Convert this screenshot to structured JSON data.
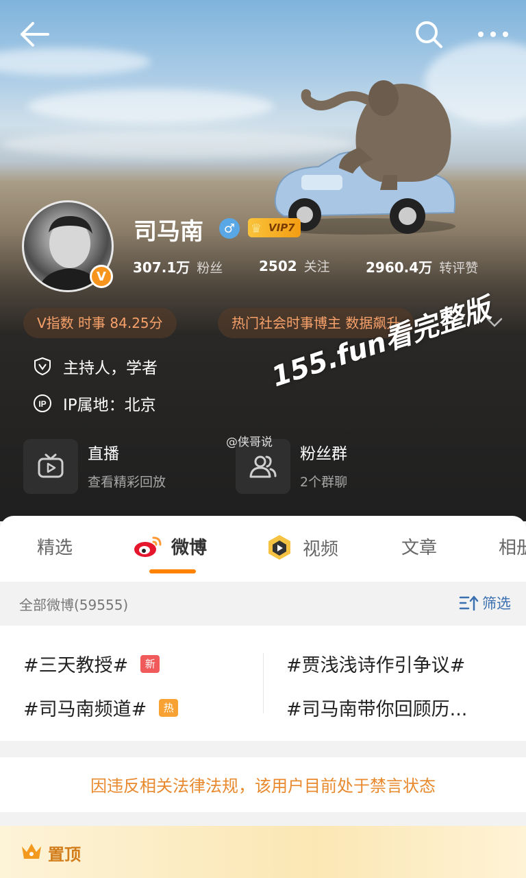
{
  "profile": {
    "name": "司马南",
    "vip_label": "VIP7",
    "verified_mark": "V",
    "stats": [
      {
        "value": "307.1万",
        "label": "粉丝"
      },
      {
        "value": "2502",
        "label": "关注"
      },
      {
        "value": "2960.4万",
        "label": "转评赞"
      }
    ],
    "chips": [
      "V指数 时事 84.25分",
      "热门社会时事博主 数据飙升"
    ],
    "occupation": "主持人，学者",
    "ip_location": "IP属地：北京"
  },
  "cards": [
    {
      "title": "直播",
      "subtitle": "查看精彩回放",
      "icon": "tv-icon"
    },
    {
      "title": "粉丝群",
      "subtitle": "2个群聊",
      "icon": "group-icon"
    }
  ],
  "overlay": {
    "watermark": "155.fun看完整版",
    "credit": "@侠哥说"
  },
  "tabs": [
    "精选",
    "微博",
    "视频",
    "文章",
    "相册"
  ],
  "active_tab": "微博",
  "feed": {
    "count_label": "全部微博(59555)",
    "filter_label": "筛选"
  },
  "topics": [
    {
      "text": "#三天教授#",
      "badge": "新",
      "badge_color": "#f05a5a"
    },
    {
      "text": "#贾浅浅诗作引争议#"
    },
    {
      "text": "#司马南频道#",
      "badge": "热",
      "badge_color": "#f7a233"
    },
    {
      "text": "#司马南带你回顾历..."
    }
  ],
  "notice": "因违反相关法律法规，该用户目前处于禁言状态",
  "pinned_label": "置顶",
  "colors": {
    "accent": "#ff8200",
    "notice": "#e8892e",
    "link": "#3a6fb0"
  }
}
